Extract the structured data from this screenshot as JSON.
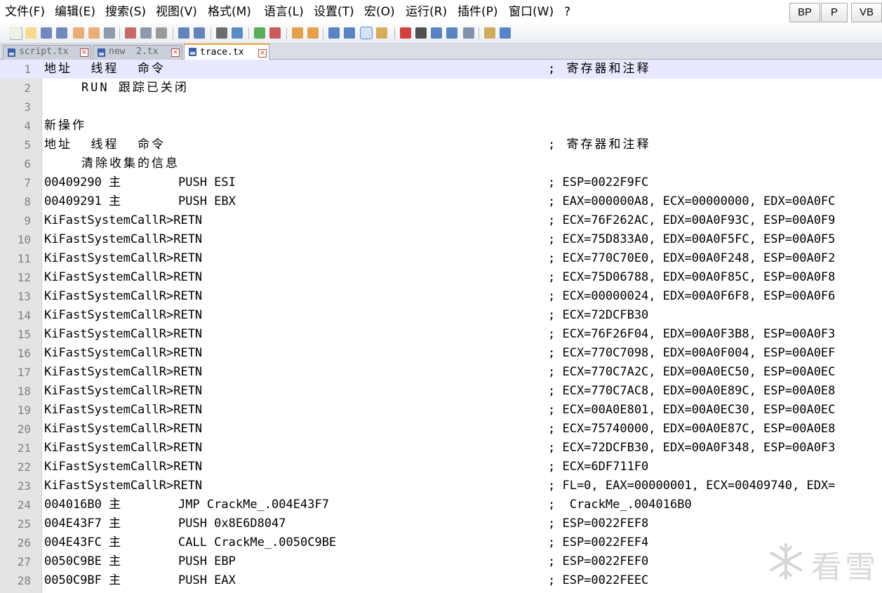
{
  "menu": [
    "文件(F)",
    "编辑(E)",
    "搜索(S)",
    "视图(V)",
    "格式(M)",
    "语言(L)",
    "设置(T)",
    "宏(O)",
    "运行(R)",
    "插件(P)",
    "窗口(W)",
    "?"
  ],
  "right_buttons": [
    "BP",
    "P",
    "VB"
  ],
  "toolbar_icons": [
    "new-file-icon",
    "open-file-icon",
    "save-icon",
    "save-all-icon",
    "close-icon",
    "close-all-icon",
    "print-icon",
    "cut-icon",
    "copy-icon",
    "paste-icon",
    "undo-icon",
    "redo-icon",
    "find-icon",
    "replace-icon",
    "zoom-in-icon",
    "zoom-out-icon",
    "sync-vertical-icon",
    "sync-horizontal-icon",
    "word-wrap-icon",
    "show-all-chars-icon",
    "indent-guide-icon",
    "user-language-icon",
    "record-macro-icon",
    "stop-record-icon",
    "play-macro-icon",
    "run-macro-multiple-icon",
    "save-macro-icon",
    "trim-icon",
    "spell-check-icon"
  ],
  "tabs": [
    {
      "label": "script.tx",
      "active": false
    },
    {
      "label": "new  2.tx",
      "active": false
    },
    {
      "label": "trace.tx",
      "active": true
    }
  ],
  "lines": [
    {
      "n": "1",
      "code": "地址  线程  命令",
      "comment": "; 寄存器和注释",
      "current": true
    },
    {
      "n": "2",
      "code": "    RUN 跟踪已关闭",
      "comment": ""
    },
    {
      "n": "3",
      "code": "",
      "comment": ""
    },
    {
      "n": "4",
      "code": "新操作",
      "comment": ""
    },
    {
      "n": "5",
      "code": "地址  线程  命令",
      "comment": "; 寄存器和注释"
    },
    {
      "n": "6",
      "code": "    清除收集的信息",
      "comment": ""
    },
    {
      "n": "7",
      "code": "00409290 主        PUSH ESI",
      "comment": "; ESP=0022F9FC"
    },
    {
      "n": "8",
      "code": "00409291 主        PUSH EBX",
      "comment": "; EAX=000000A8, ECX=00000000, EDX=00A0FC"
    },
    {
      "n": "9",
      "code": "KiFastSystemCallR>RETN",
      "comment": "; ECX=76F262AC, EDX=00A0F93C, ESP=00A0F9"
    },
    {
      "n": "10",
      "code": "KiFastSystemCallR>RETN",
      "comment": "; ECX=75D833A0, EDX=00A0F5FC, ESP=00A0F5"
    },
    {
      "n": "11",
      "code": "KiFastSystemCallR>RETN",
      "comment": "; ECX=770C70E0, EDX=00A0F248, ESP=00A0F2"
    },
    {
      "n": "12",
      "code": "KiFastSystemCallR>RETN",
      "comment": "; ECX=75D06788, EDX=00A0F85C, ESP=00A0F8"
    },
    {
      "n": "13",
      "code": "KiFastSystemCallR>RETN",
      "comment": "; ECX=00000024, EDX=00A0F6F8, ESP=00A0F6"
    },
    {
      "n": "14",
      "code": "KiFastSystemCallR>RETN",
      "comment": "; ECX=72DCFB30"
    },
    {
      "n": "15",
      "code": "KiFastSystemCallR>RETN",
      "comment": "; ECX=76F26F04, EDX=00A0F3B8, ESP=00A0F3"
    },
    {
      "n": "16",
      "code": "KiFastSystemCallR>RETN",
      "comment": "; ECX=770C7098, EDX=00A0F004, ESP=00A0EF"
    },
    {
      "n": "17",
      "code": "KiFastSystemCallR>RETN",
      "comment": "; ECX=770C7A2C, EDX=00A0EC50, ESP=00A0EC"
    },
    {
      "n": "18",
      "code": "KiFastSystemCallR>RETN",
      "comment": "; ECX=770C7AC8, EDX=00A0E89C, ESP=00A0E8"
    },
    {
      "n": "19",
      "code": "KiFastSystemCallR>RETN",
      "comment": "; ECX=00A0E801, EDX=00A0EC30, ESP=00A0EC"
    },
    {
      "n": "20",
      "code": "KiFastSystemCallR>RETN",
      "comment": "; ECX=75740000, EDX=00A0E87C, ESP=00A0E8"
    },
    {
      "n": "21",
      "code": "KiFastSystemCallR>RETN",
      "comment": "; ECX=72DCFB30, EDX=00A0F348, ESP=00A0F3"
    },
    {
      "n": "22",
      "code": "KiFastSystemCallR>RETN",
      "comment": "; ECX=6DF711F0"
    },
    {
      "n": "23",
      "code": "KiFastSystemCallR>RETN",
      "comment": "; FL=0, EAX=00000001, ECX=00409740, EDX="
    },
    {
      "n": "24",
      "code": "004016B0 主        JMP CrackMe_.004E43F7",
      "comment": ";  CrackMe_.004016B0"
    },
    {
      "n": "25",
      "code": "004E43F7 主        PUSH 0x8E6D8047",
      "comment": "; ESP=0022FEF8"
    },
    {
      "n": "26",
      "code": "004E43FC 主        CALL CrackMe_.0050C9BE",
      "comment": "; ESP=0022FEF4"
    },
    {
      "n": "27",
      "code": "0050C9BE 主        PUSH EBP",
      "comment": "; ESP=0022FEF0"
    },
    {
      "n": "28",
      "code": "0050C9BF 主        PUSH EAX",
      "comment": "; ESP=0022FEEC"
    }
  ],
  "watermark": {
    "icon": "snowflake-icon",
    "text": "看雪"
  }
}
